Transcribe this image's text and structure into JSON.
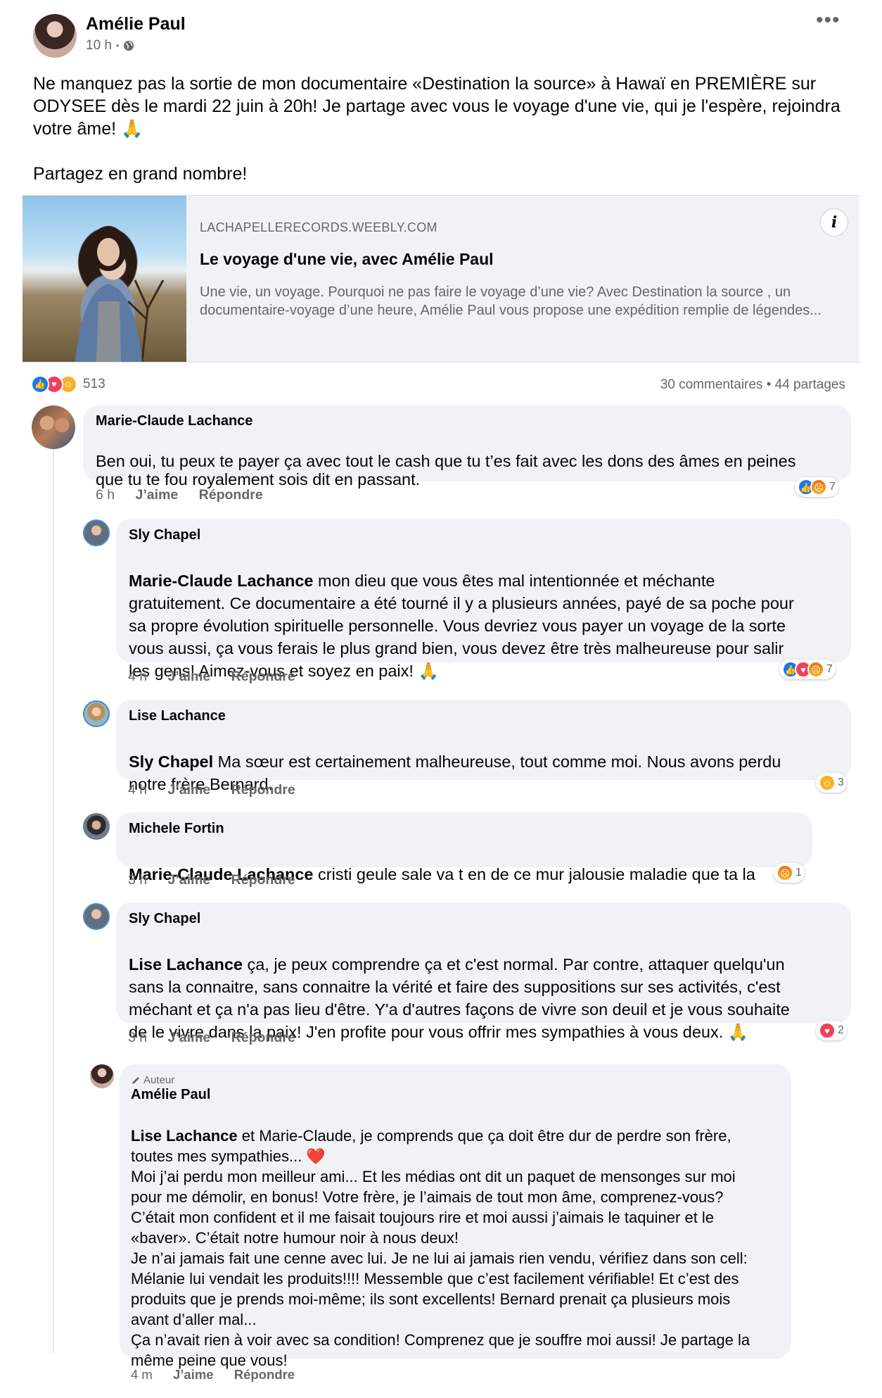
{
  "post": {
    "author": "Amélie Paul",
    "time": "10 h",
    "privacy_sep": "•",
    "more": "•••",
    "text_lines": [
      "Ne manquez pas la sortie de mon documentaire «Destination la source» à Hawaï en PREMIÈRE sur",
      "ODYSEE dès le mardi 22 juin à 20h! Je partage avec vous le voyage d'une vie, qui je l'espère, rejoindra",
      "votre âme! 🙏",
      "",
      "Partagez en grand nombre!"
    ]
  },
  "link": {
    "domain": "LACHAPELLERECORDS.WEEBLY.COM",
    "title": "Le voyage d'une vie, avec Amélie Paul",
    "description": "Une vie, un voyage. Pourquoi ne pas faire le voyage d’une vie? Avec Destination la source , un documentaire-voyage d’une heure, Amélie Paul vous propose une expédition remplie de légendes...",
    "info_icon": "i"
  },
  "stats": {
    "reaction_count": "513",
    "comments_shares": "30 commentaires • 44 partages"
  },
  "actions": {
    "like": "J’aime",
    "reply": "Répondre"
  },
  "comments": [
    {
      "name": "Marie-Claude Lachance",
      "mention": "",
      "text": "Ben oui, tu peux te payer ça avec tout le cash que tu t’es fait avec les dons des âmes en peines\nque tu te fou royalement sois dit en passant.",
      "time": "6 h",
      "reaction_count": "7"
    },
    {
      "name": "Sly Chapel",
      "mention": "Marie-Claude Lachance",
      "text": " mon dieu que vous êtes mal intentionnée et méchante\ngratuitement. Ce documentaire a été tourné il y a plusieurs années, payé de sa poche pour\nsa propre évolution spirituelle personnelle. Vous devriez vous payer un voyage de la sorte\nvous aussi, ça vous ferais le plus grand bien, vous devez être très malheureuse pour salir\nles gens! Aimez-vous et soyez en paix! 🙏",
      "time": "4 h",
      "reaction_count": "7"
    },
    {
      "name": "Lise Lachance",
      "mention": "Sly Chapel",
      "text": "  Ma sœur est certainement malheureuse, tout comme moi. Nous avons perdu\nnotre frère Bernard.",
      "time": "4 h",
      "reaction_count": "3"
    },
    {
      "name": "Michele Fortin",
      "mention": "Marie-Claude Lachance",
      "text": " cristi geule sale  va t en de ce mur jalousie maladie que ta la",
      "time": "3 h",
      "reaction_count": "1"
    },
    {
      "name": "Sly Chapel",
      "mention": "Lise Lachance",
      "text": "  ça, je peux comprendre ça et c'est normal. Par contre, attaquer quelqu'un\nsans la connaitre, sans connaitre la vérité et faire des suppositions sur ses activités, c'est\nméchant et ça n'a pas lieu d'être. Y'a d'autres façons de vivre son deuil et je vous souhaite\nde le vivre dans la paix! J'en profite pour vous offrir mes sympathies à vous deux. 🙏",
      "time": "3 h",
      "reaction_count": "2"
    },
    {
      "badge": "Auteur",
      "name": "Amélie Paul",
      "mention": "Lise Lachance",
      "text": " et Marie-Claude, je comprends que ça doit être dur de perdre son frère,\ntoutes mes sympathies... ❤️\nMoi j’ai perdu mon meilleur ami... Et les médias ont dit un paquet de mensonges sur moi\npour me démolir, en bonus! Votre frère, je l’aimais de tout mon âme, comprenez-vous?\nC’était mon confident et il me faisait toujours rire et moi aussi j’aimais le taquiner et le\n«baver». C’était notre humour noir à nous deux!\nJe n’ai jamais fait une cenne avec lui. Je ne lui ai jamais rien vendu, vérifiez dans son cell:\nMélanie lui vendait les produits!!!! Messemble que c’est facilement vérifiable! Et c’est des\nproduits que je prends moi-même; ils sont excellents! Bernard prenait ça plusieurs mois\navant d’aller mal...\nÇa n’avait rien à voir avec sa condition! Comprenez que je souffre moi aussi! Je partage la\nmême peine que vous!",
      "time": "4 m"
    }
  ]
}
